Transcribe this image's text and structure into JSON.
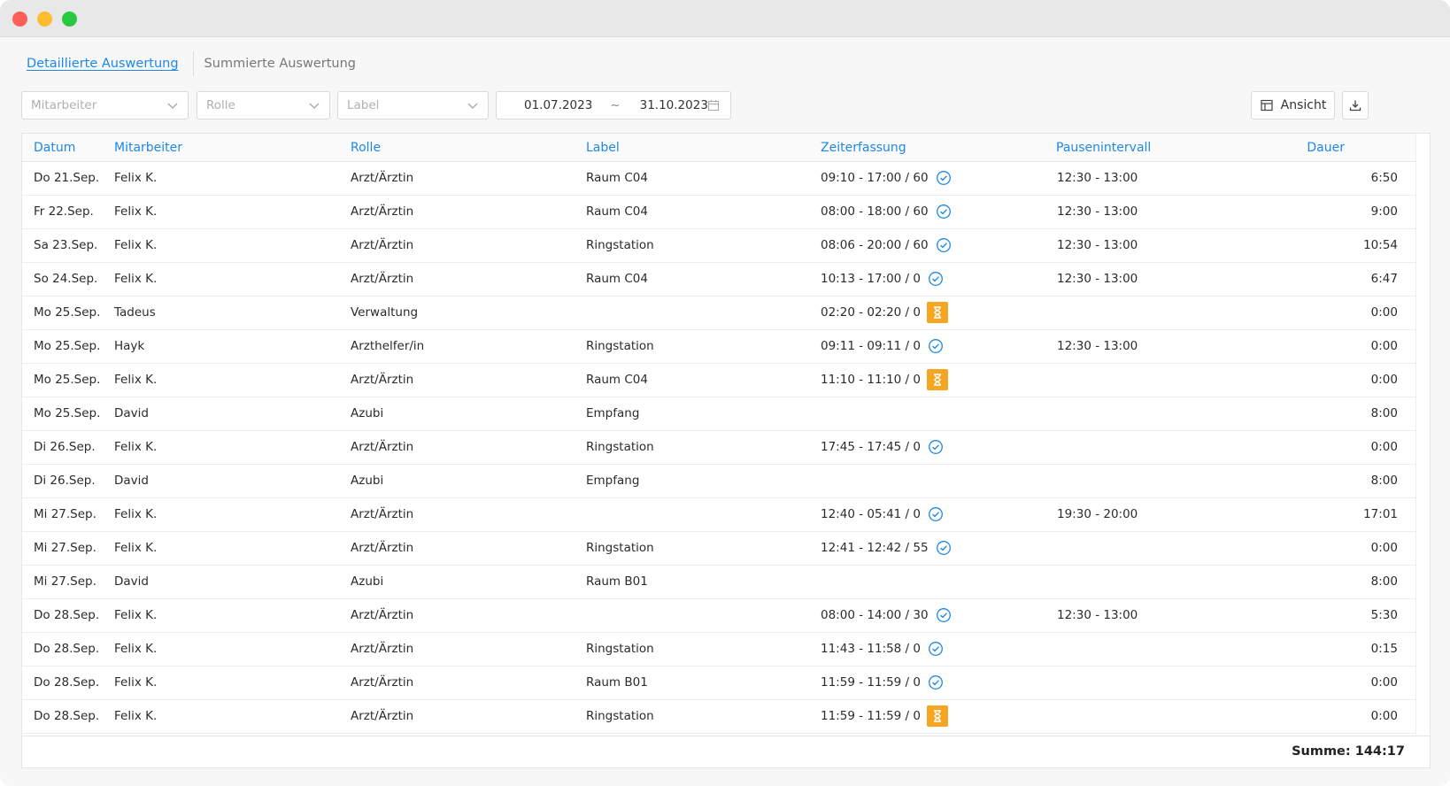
{
  "tabs": {
    "detailed": "Detaillierte Auswertung",
    "summed": "Summierte Auswertung"
  },
  "filters": {
    "employee_placeholder": "Mitarbeiter",
    "role_placeholder": "Rolle",
    "label_placeholder": "Label",
    "date_from": "01.07.2023",
    "date_sep": "~",
    "date_to": "31.10.2023"
  },
  "toolbar": {
    "view_label": "Ansicht",
    "download_icon": "download-icon"
  },
  "table": {
    "headers": [
      "Datum",
      "Mitarbeiter",
      "Rolle",
      "Label",
      "Zeiterfassung",
      "Pausenintervall",
      "Dauer"
    ],
    "rows": [
      {
        "date": "Do 21.Sep.",
        "employee": "Felix K.",
        "role": "Arzt/Ärztin",
        "label": "Raum C04",
        "time": "09:10 - 17:00 / 60",
        "status": "check",
        "pause": "12:30 - 13:00",
        "duration": "6:50"
      },
      {
        "date": "Fr 22.Sep.",
        "employee": "Felix K.",
        "role": "Arzt/Ärztin",
        "label": "Raum C04",
        "time": "08:00 - 18:00 / 60",
        "status": "check",
        "pause": "12:30 - 13:00",
        "duration": "9:00"
      },
      {
        "date": "Sa 23.Sep.",
        "employee": "Felix K.",
        "role": "Arzt/Ärztin",
        "label": "Ringstation",
        "time": "08:06 - 20:00 / 60",
        "status": "check",
        "pause": "12:30 - 13:00",
        "duration": "10:54"
      },
      {
        "date": "So 24.Sep.",
        "employee": "Felix K.",
        "role": "Arzt/Ärztin",
        "label": "Raum C04",
        "time": "10:13 - 17:00 / 0",
        "status": "check",
        "pause": "12:30 - 13:00",
        "duration": "6:47"
      },
      {
        "date": "Mo 25.Sep.",
        "employee": "Tadeus",
        "role": "Verwaltung",
        "label": "",
        "time": "02:20 - 02:20 / 0",
        "status": "pending",
        "pause": "",
        "duration": "0:00"
      },
      {
        "date": "Mo 25.Sep.",
        "employee": "Hayk",
        "role": "Arzthelfer/in",
        "label": "Ringstation",
        "time": "09:11 - 09:11 / 0",
        "status": "check",
        "pause": "12:30 - 13:00",
        "duration": "0:00"
      },
      {
        "date": "Mo 25.Sep.",
        "employee": "Felix K.",
        "role": "Arzt/Ärztin",
        "label": "Raum C04",
        "time": "11:10 - 11:10 / 0",
        "status": "pending",
        "pause": "",
        "duration": "0:00"
      },
      {
        "date": "Mo 25.Sep.",
        "employee": "David",
        "role": "Azubi",
        "label": "Empfang",
        "time": "",
        "status": "",
        "pause": "",
        "duration": "8:00"
      },
      {
        "date": "Di 26.Sep.",
        "employee": "Felix K.",
        "role": "Arzt/Ärztin",
        "label": "Ringstation",
        "time": "17:45 - 17:45 / 0",
        "status": "check",
        "pause": "",
        "duration": "0:00"
      },
      {
        "date": "Di 26.Sep.",
        "employee": "David",
        "role": "Azubi",
        "label": "Empfang",
        "time": "",
        "status": "",
        "pause": "",
        "duration": "8:00"
      },
      {
        "date": "Mi 27.Sep.",
        "employee": "Felix K.",
        "role": "Arzt/Ärztin",
        "label": "",
        "time": "12:40 - 05:41 / 0",
        "status": "check",
        "pause": "19:30 - 20:00",
        "duration": "17:01"
      },
      {
        "date": "Mi 27.Sep.",
        "employee": "Felix K.",
        "role": "Arzt/Ärztin",
        "label": "Ringstation",
        "time": "12:41 - 12:42 / 55",
        "status": "check",
        "pause": "",
        "duration": "0:00"
      },
      {
        "date": "Mi 27.Sep.",
        "employee": "David",
        "role": "Azubi",
        "label": "Raum B01",
        "time": "",
        "status": "",
        "pause": "",
        "duration": "8:00"
      },
      {
        "date": "Do 28.Sep.",
        "employee": "Felix K.",
        "role": "Arzt/Ärztin",
        "label": "",
        "time": "08:00 - 14:00 / 30",
        "status": "check",
        "pause": "12:30 - 13:00",
        "duration": "5:30"
      },
      {
        "date": "Do 28.Sep.",
        "employee": "Felix K.",
        "role": "Arzt/Ärztin",
        "label": "Ringstation",
        "time": "11:43 - 11:58 / 0",
        "status": "check",
        "pause": "",
        "duration": "0:15"
      },
      {
        "date": "Do 28.Sep.",
        "employee": "Felix K.",
        "role": "Arzt/Ärztin",
        "label": "Raum B01",
        "time": "11:59 - 11:59 / 0",
        "status": "check",
        "pause": "",
        "duration": "0:00"
      },
      {
        "date": "Do 28.Sep.",
        "employee": "Felix K.",
        "role": "Arzt/Ärztin",
        "label": "Ringstation",
        "time": "11:59 - 11:59 / 0",
        "status": "pending",
        "pause": "",
        "duration": "0:00"
      }
    ]
  },
  "footer": {
    "total": "Summe: 144:17"
  },
  "colors": {
    "accent": "#1e88e5",
    "pending": "#f5a623"
  }
}
